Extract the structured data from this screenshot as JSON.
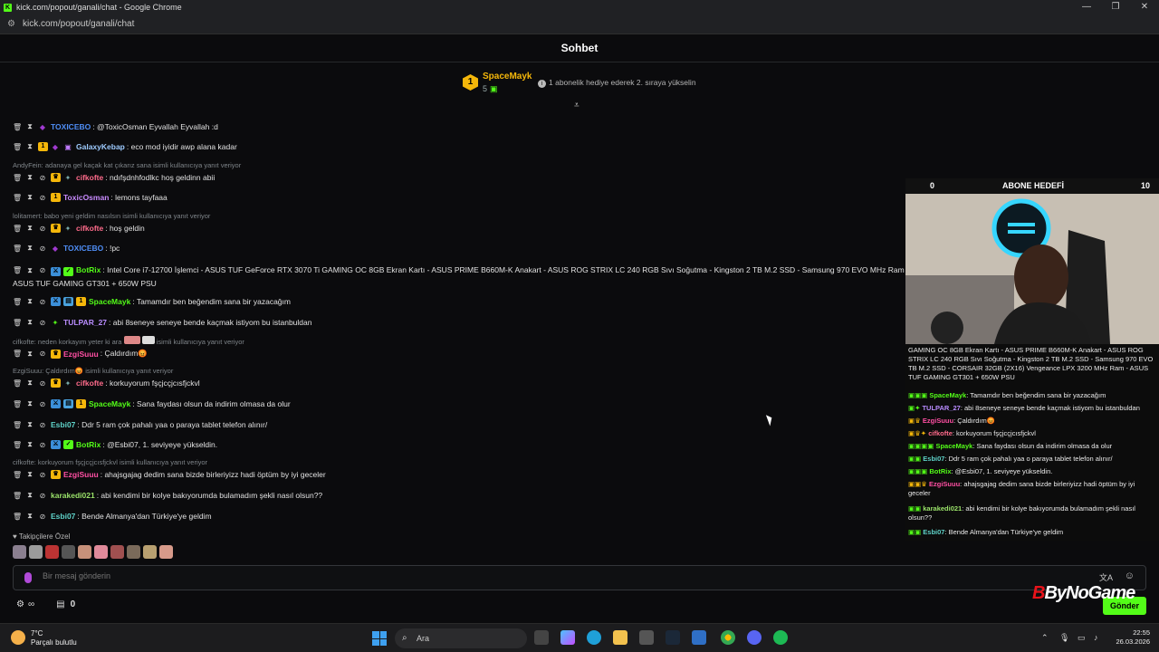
{
  "browser": {
    "window_title": "kick.com/popout/ganali/chat - Google Chrome",
    "url": "kick.com/popout/ganali/chat",
    "favicon_letter": "K"
  },
  "chat": {
    "header_title": "Sohbet",
    "top_gifter": {
      "rank": "1",
      "name": "SpaceMayk",
      "count": "5"
    },
    "promo_text": "1 abonelik hediye ederek 2. sıraya yükselin",
    "messages": [
      {
        "user": "TOXICEBO",
        "color": "#4f8ef7",
        "text": ": @ToxicOsman Eyvallah Eyvallah :d"
      },
      {
        "user": "GalaxyKebap",
        "color": "#9ecbff",
        "text": ": eco mod iyidir awp alana kadar"
      },
      {
        "user": "cifkofte",
        "color": "#ff6b8b",
        "text": ": ndıfşdnhfodlkc hoş geldinn abii"
      },
      {
        "user": "ToxicOsman",
        "color": "#c98bff",
        "text": ": lemons tayfaaa"
      },
      {
        "user": "cifkofte",
        "color": "#ff6b8b",
        "text": ": hoş geldin"
      },
      {
        "user": "TOXICEBO",
        "color": "#4f8ef7",
        "text": ": !pc"
      },
      {
        "user": "BotRix",
        "color": "#53fc18",
        "text": ": Intel Core i7-12700 İşlemci - ASUS TUF GeForce RTX 3070 Ti GAMING OC 8GB Ekran Kartı - ASUS PRIME B660M-K Anakart - ASUS ROG STRIX LC 240 RGB Sıvı Soğutma - Kingston 2 TB M.2 SSD - Samsung 970 EVO MHz Ram - ASUS TUF GAMING GT301 + 650W PSU"
      },
      {
        "user": "SpaceMayk",
        "color": "#53fc18",
        "text": ": Tamamdır ben beğendim sana bir yazacağım"
      },
      {
        "user": "TULPAR_27",
        "color": "#b98cff",
        "text": ": abi 8seneye seneye bende kaçmak istiyom bu istanbuldan"
      },
      {
        "user": "EzgiSuuu",
        "color": "#ff4fa3",
        "text": ": Çaldırdım😡"
      },
      {
        "user": "cifkofte",
        "color": "#ff6b8b",
        "text": ": korkuyorum fşçjcçjcısfjckvl"
      },
      {
        "user": "SpaceMayk",
        "color": "#53fc18",
        "text": ": Sana faydası olsun da indirim olmasa da olur"
      },
      {
        "user": "Esbi07",
        "color": "#5fd3c9",
        "text": ": Ddr 5 ram çok pahalı yaa o paraya tablet telefon alınır/"
      },
      {
        "user": "BotRix",
        "color": "#53fc18",
        "text": ": @Esbi07, 1. seviyeye yükseldin."
      },
      {
        "user": "EzgiSuuu",
        "color": "#ff4fa3",
        "text": ": ahajsgajag dedim sana bizde birleriyizz hadi öptüm by iyi geceler"
      },
      {
        "user": "karakedi021",
        "color": "#9be36a",
        "text": ": abi kendimi bir kolye bakıyorumda bulamadım şekli nasıl olsun??"
      },
      {
        "user": "Esbi07",
        "color": "#5fd3c9",
        "text": ": Bende Almanya'dan Türkiye'ye geldim"
      }
    ],
    "replies": [
      "AndyFein: adanaya gel kaçak kat çıkarız sana isimli kullanıcıya yanıt veriyor",
      "lolitamert: babo yeni geldim nasılsın isimli kullanıcıya yanıt veriyor",
      "cifkofte: neden korkayım yeter ki ara",
      "isimli kullanıcıya yanıt veriyor",
      "EzgiSuuu: Çaldırdım😡 isimli kullanıcıya yanıt veriyor",
      "cifkofte: korkuyorum fşçjcçjcısfjckvl isimli kullanıcıya yanıt veriyor"
    ],
    "followers_only_label": "Takipçilere Özel",
    "input_placeholder": "Bir mesaj gönderin",
    "send_label": "Gönder",
    "bottom_count": "0"
  },
  "overlay": {
    "goal_left": "0",
    "goal_title": "ABONE HEDEFİ",
    "goal_right": "10",
    "botrix_tail": "GAMING OC 8GB Ekran Kartı - ASUS PRIME B660M-K Anakart - ASUS ROG STRIX LC 240 RGB Sıvı Soğutma - Kingston 2 TB M.2 SSD - Samsung 970 EVO TB M.2 SSD - CORSAIR 32GB (2X16) Vengeance LPX 3200 MHz Ram - ASUS TUF GAMING GT301 + 650W PSU",
    "lines": [
      {
        "user": "SpaceMayk",
        "color": "#53fc18",
        "text": ": Tamamdır ben beğendim sana bir yazacağım"
      },
      {
        "user": "TULPAR_27",
        "color": "#b98cff",
        "text": ": abi 8seneye seneye bende kaçmak istiyom bu istanbuldan"
      },
      {
        "user": "EzgiSuuu",
        "color": "#ff4fa3",
        "text": ": Çaldırdım😡"
      },
      {
        "user": "cifkofte",
        "color": "#ff6b8b",
        "text": ": korkuyorum fşçjcçjcısfjckvl"
      },
      {
        "user": "SpaceMayk",
        "color": "#53fc18",
        "text": ": Sana faydası olsun da indirim olmasa da olur"
      },
      {
        "user": "Esbi07",
        "color": "#5fd3c9",
        "text": ": Ddr 5 ram çok pahalı yaa o paraya tablet telefon alınır/"
      },
      {
        "user": "BotRix",
        "color": "#53fc18",
        "text": ": @Esbi07, 1. seviyeye yükseldin."
      },
      {
        "user": "EzgiSuuu",
        "color": "#ff4fa3",
        "text": ": ahajsgajag dedim sana bizde birleriyizz hadi öptüm by iyi geceler"
      },
      {
        "user": "karakedi021",
        "color": "#9be36a",
        "text": ": abi kendimi bir kolye bakıyorumda bulamadım şekli nasıl olsun??"
      },
      {
        "user": "Esbi07",
        "color": "#5fd3c9",
        "text": ": Bende Almanya'dan Türkiye'ye geldim"
      }
    ],
    "brand": "ByNoGame",
    "brand_mark": "B"
  },
  "taskbar": {
    "temperature": "7°C",
    "weather": "Parçalı bulutlu",
    "search_label": "Ara",
    "time": "22:55",
    "date": "26.03.2026"
  },
  "colors": {
    "accent": "#53fc18",
    "gifter_gold": "#f5b70a"
  }
}
